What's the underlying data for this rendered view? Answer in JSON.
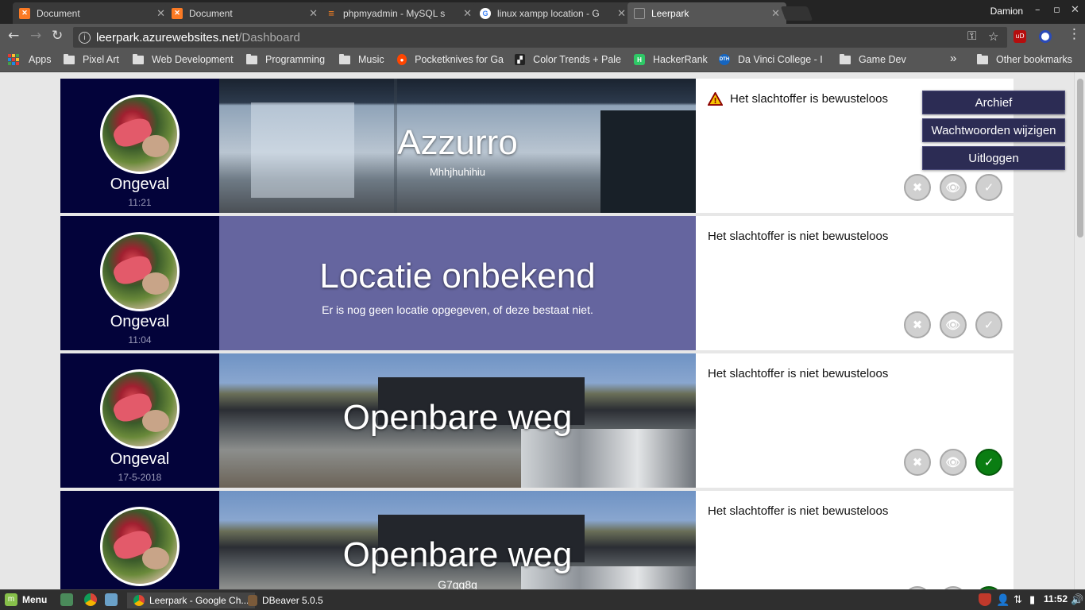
{
  "browser": {
    "tabs": [
      {
        "title": "Document",
        "icon": "xampp-icon",
        "color": "#fb7a24"
      },
      {
        "title": "Document",
        "icon": "xampp-icon",
        "color": "#fb7a24"
      },
      {
        "title": "phpmyadmin - MySQL s",
        "icon": "stackoverflow-icon",
        "color": "#f48024"
      },
      {
        "title": "linux xampp location - G",
        "icon": "google-icon",
        "color": "#4285f4"
      },
      {
        "title": "Leerpark",
        "icon": "page-icon",
        "color": "#999999"
      }
    ],
    "active_tab": 4,
    "user": "Damion",
    "url_host": "leerpark.azurewebsites.net",
    "url_path": "/Dashboard",
    "bookmarks": [
      {
        "label": "Apps",
        "icon": "apps-icon"
      },
      {
        "label": "Pixel Art",
        "icon": "folder-icon"
      },
      {
        "label": "Web Development",
        "icon": "folder-icon"
      },
      {
        "label": "Programming",
        "icon": "folder-icon"
      },
      {
        "label": "Music",
        "icon": "folder-icon"
      },
      {
        "label": "Pocketknives for Ga",
        "icon": "reddit-icon"
      },
      {
        "label": "Color Trends + Pale",
        "icon": "palette-icon"
      },
      {
        "label": "HackerRank",
        "icon": "hackerrank-icon"
      },
      {
        "label": "Da Vinci College - I",
        "icon": "davinci-icon"
      },
      {
        "label": "Game Dev",
        "icon": "folder-icon"
      }
    ],
    "overflow": "»",
    "other_bookmarks": "Other bookmarks"
  },
  "dashboard": {
    "menu": {
      "archive": "Archief",
      "change_passwords": "Wachtwoorden wijzigen",
      "logout": "Uitloggen"
    },
    "reports": [
      {
        "type": "Ongeval",
        "time": "11:21",
        "location": "Azzurro",
        "detail": "Mhhjhuhihiu",
        "status": "Het slachtoffer is bewusteloos",
        "warning": true,
        "approved": false,
        "background": "building"
      },
      {
        "type": "Ongeval",
        "time": "11:04",
        "location": "Locatie onbekend",
        "detail": "Er is nog geen locatie opgegeven, of deze bestaat niet.",
        "status": "Het slachtoffer is niet bewusteloos",
        "warning": false,
        "approved": false,
        "background": "plain"
      },
      {
        "type": "Ongeval",
        "time": "17-5-2018",
        "location": "Openbare weg",
        "detail": "",
        "status": "Het slachtoffer is niet bewusteloos",
        "warning": false,
        "approved": true,
        "background": "parking"
      },
      {
        "type": "",
        "time": "",
        "location": "Openbare weg",
        "detail": "G7gg8g",
        "status": "Het slachtoffer is niet bewusteloos",
        "warning": false,
        "approved": true,
        "background": "parking"
      }
    ]
  },
  "taskbar": {
    "menu_label": "Menu",
    "windows": [
      {
        "label": "Leerpark - Google Ch...",
        "icon": "chrome-icon"
      },
      {
        "label": "DBeaver 5.0.5",
        "icon": "dbeaver-icon"
      }
    ],
    "clock": "11:52"
  },
  "colors": {
    "navy": "#03033a",
    "purple": "#65659f",
    "approve_green": "#0a7d12",
    "menu_button": "#2c2c54"
  }
}
